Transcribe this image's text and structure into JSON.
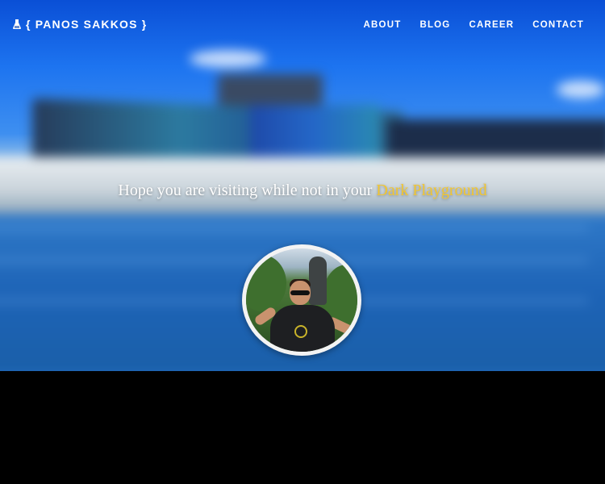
{
  "brand": {
    "icon": "flask-icon",
    "name": "{ PANOS SAKKOS }"
  },
  "nav": {
    "items": [
      {
        "label": "ABOUT"
      },
      {
        "label": "BLOG"
      },
      {
        "label": "CAREER"
      },
      {
        "label": "CONTACT"
      }
    ]
  },
  "hero": {
    "tagline_prefix": "Hope you are visiting while not in your ",
    "tagline_highlight": "Dark Playground"
  },
  "colors": {
    "highlight": "#f2c630",
    "text": "#ffffff",
    "background_bottom": "#000000"
  }
}
